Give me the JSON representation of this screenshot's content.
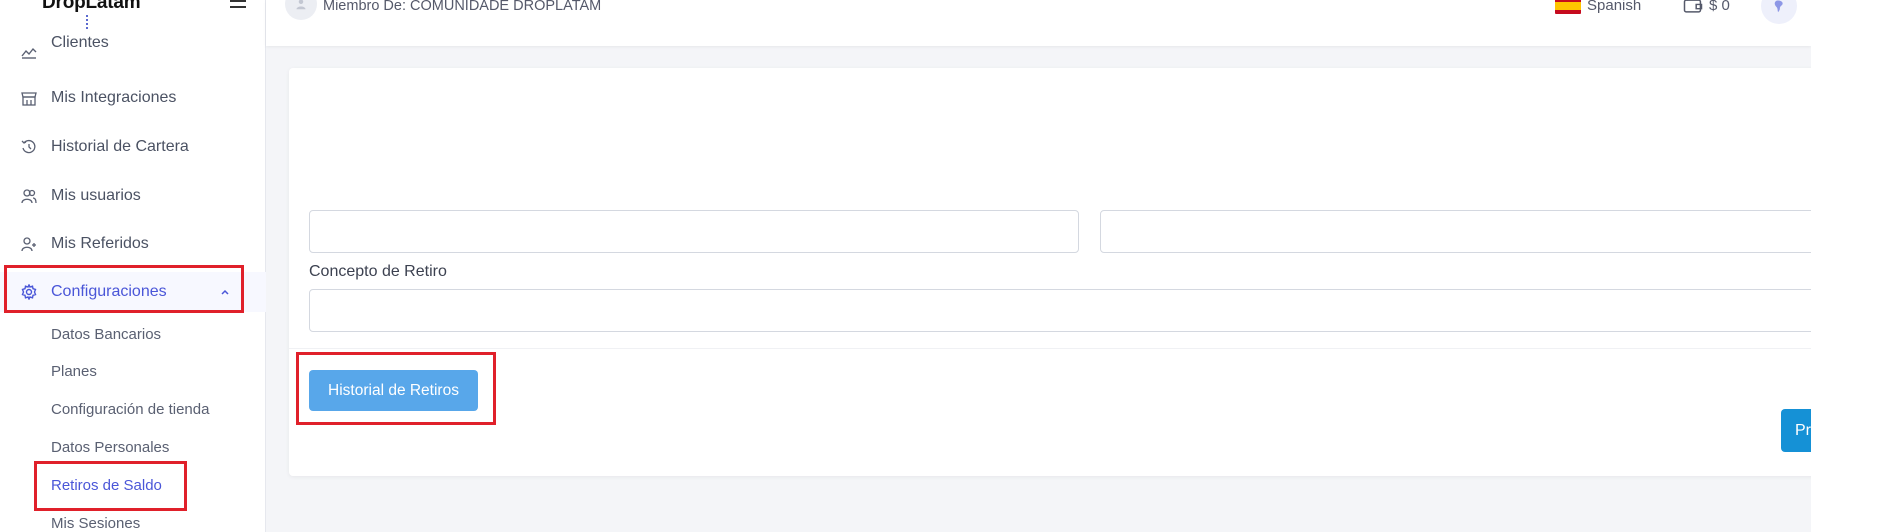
{
  "sidebar": {
    "brand": "DropLatam",
    "nav": [
      {
        "label": "Clientes",
        "icon": "chart-line-icon"
      },
      {
        "label": "Mis Integraciones",
        "icon": "store-icon"
      },
      {
        "label": "Historial de Cartera",
        "icon": "history-icon"
      },
      {
        "label": "Mis usuarios",
        "icon": "users-icon"
      },
      {
        "label": "Mis Referidos",
        "icon": "user-plus-icon"
      },
      {
        "label": "Configuraciones",
        "icon": "gear-icon",
        "active": true,
        "expanded": true
      }
    ],
    "sub_items": [
      {
        "label": "Datos Bancarios"
      },
      {
        "label": "Planes"
      },
      {
        "label": "Configuración de tienda"
      },
      {
        "label": "Datos Personales"
      },
      {
        "label": "Retiros de Saldo",
        "active": true
      },
      {
        "label": "Mis Sesiones"
      }
    ]
  },
  "topbar": {
    "member_text": "Miembro De: COMUNIDADE DROPLATAM",
    "language": "Spanish",
    "wallet_amount": "$ 0"
  },
  "form": {
    "field1_value": "",
    "field2_value": "",
    "concepto_label": "Concepto de Retiro",
    "concepto_value": "",
    "history_button": "Historial de Retiros",
    "process_button": "Pro"
  },
  "colors": {
    "accent": "#4a56d8",
    "history_button": "#58a7ea",
    "process_button": "#1591d6",
    "highlight": "#e0202a"
  }
}
